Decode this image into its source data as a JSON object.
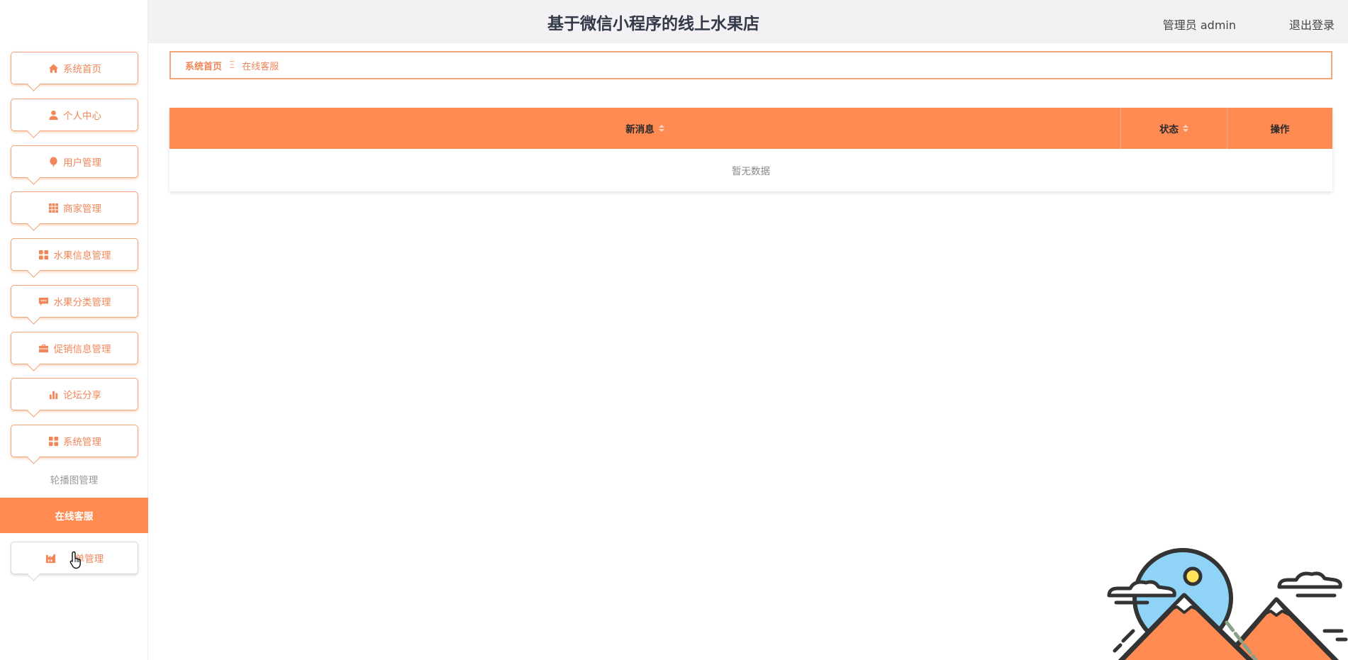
{
  "header": {
    "title": "基于微信小程序的线上水果店",
    "user": "管理员 admin",
    "logout": "退出登录"
  },
  "sidebar": {
    "items": [
      {
        "label": "系统首页",
        "icon": "home-icon"
      },
      {
        "label": "个人中心",
        "icon": "user-icon"
      },
      {
        "label": "用户管理",
        "icon": "balloon-icon"
      },
      {
        "label": "商家管理",
        "icon": "grid-icon"
      },
      {
        "label": "水果信息管理",
        "icon": "apps-icon"
      },
      {
        "label": "水果分类管理",
        "icon": "message-icon"
      },
      {
        "label": "促销信息管理",
        "icon": "briefcase-icon"
      },
      {
        "label": "论坛分享",
        "icon": "bar-chart-icon"
      },
      {
        "label": "系统管理",
        "icon": "apps-icon"
      }
    ],
    "sub_items": [
      {
        "label": "轮播图管理",
        "active": false
      },
      {
        "label": "在线客服",
        "active": true
      }
    ],
    "last_item": {
      "label": "单管理",
      "icon": "factory-icon"
    }
  },
  "breadcrumb": {
    "home": "系统首页",
    "separator": "Ξ",
    "current": "在线客服"
  },
  "table": {
    "columns": [
      "新消息",
      "状态",
      "操作"
    ],
    "empty_text": "暂无数据"
  },
  "colors": {
    "accent": "#ff8a52",
    "accent_text": "#f0875a",
    "border": "#f2a577",
    "header_bg": "#f3f1f3"
  }
}
